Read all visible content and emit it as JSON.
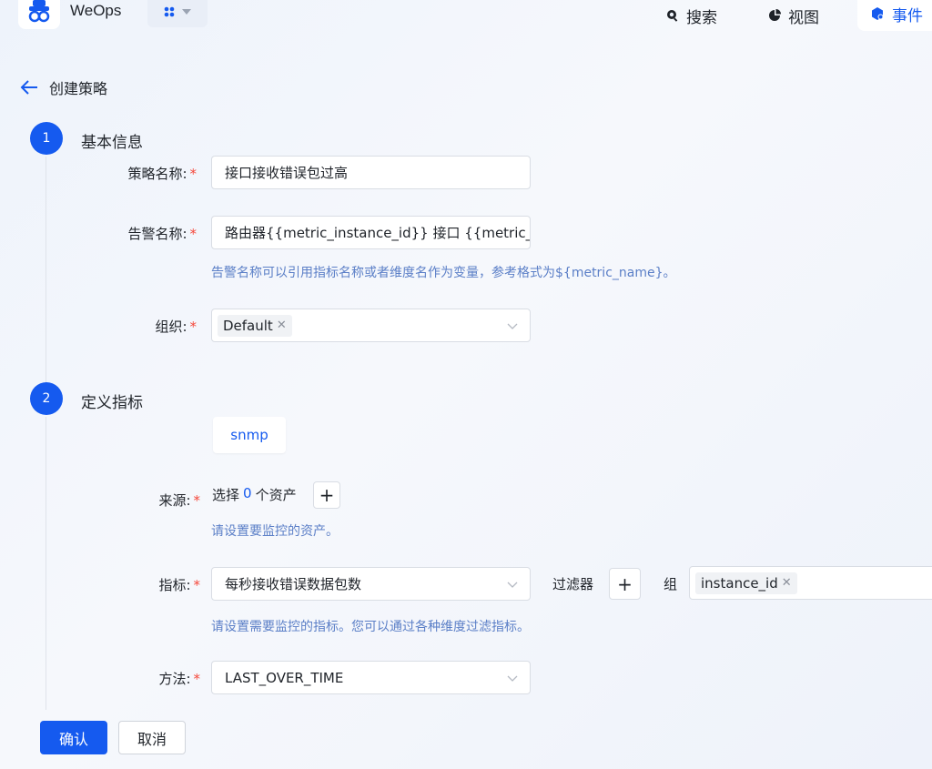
{
  "app": {
    "name": "WeOps"
  },
  "nav": {
    "search": "搜索",
    "view": "视图",
    "event": "事件"
  },
  "page": {
    "title": "创建策略"
  },
  "step1": {
    "number": "1",
    "title": "基本信息",
    "policy_name_label": "策略名称:",
    "policy_name_value": "接口接收错误包过高",
    "alert_name_label": "告警名称:",
    "alert_name_value": "路由器{{metric_instance_id}} 接口 {{metric_ifD",
    "alert_name_help": "告警名称可以引用指标名称或者维度名作为变量，参考格式为${metric_name}。",
    "org_label": "组织:",
    "org_tag": "Default"
  },
  "step2": {
    "number": "2",
    "title": "定义指标",
    "plugin_tab": "snmp",
    "source_label": "来源:",
    "source_prefix": "选择",
    "source_count": "0",
    "source_suffix": "个资产",
    "source_help": "请设置要监控的资产。",
    "metric_label": "指标:",
    "metric_value": "每秒接收错误数据包数",
    "filter_label": "过滤器",
    "group_label": "组",
    "group_tag": "instance_id",
    "metric_help": "请设置需要监控的指标。您可以通过各种维度过滤指标。",
    "method_label": "方法:",
    "method_value": "LAST_OVER_TIME"
  },
  "actions": {
    "confirm": "确认",
    "cancel": "取消"
  },
  "colors": {
    "primary": "#155aef",
    "required": "#f5483b",
    "help": "#5b7fc7"
  }
}
